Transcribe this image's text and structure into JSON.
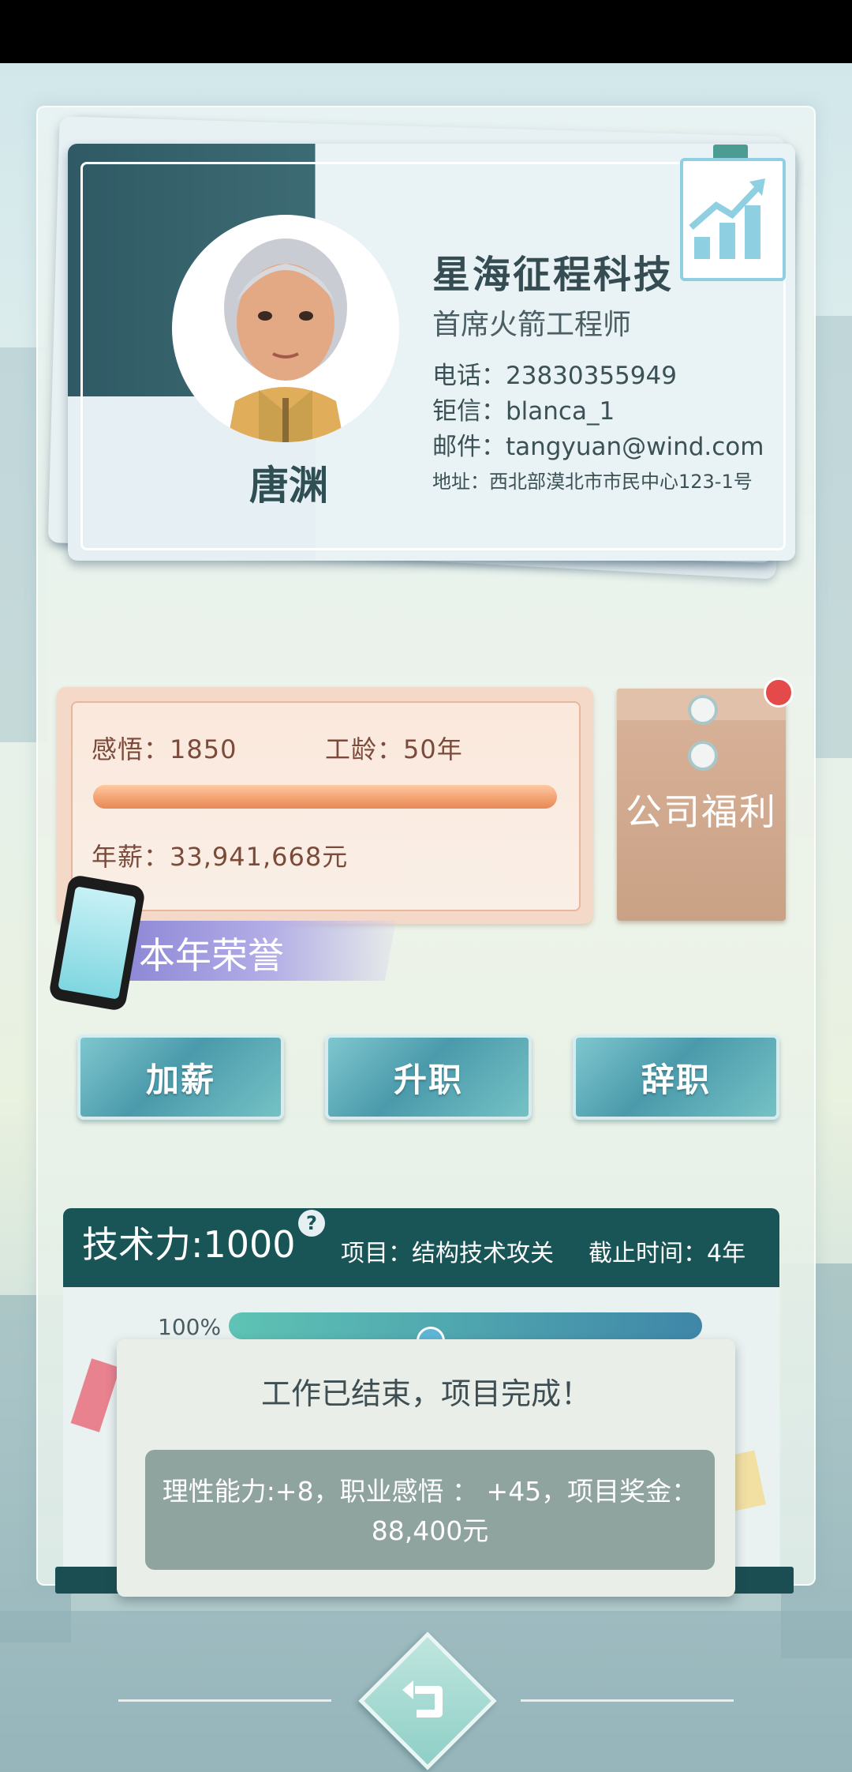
{
  "profile": {
    "name": "唐渊",
    "company": "星海征程科技",
    "job_title": "首席火箭工程师",
    "phone": "电话：23830355949",
    "chat": "钜信：blanca_1",
    "email": "邮件：tangyuan@wind.com",
    "address": "地址：西北部漠北市市民中心123-1号"
  },
  "stats": {
    "insight": "感悟：1850",
    "seniority": "工龄：50年",
    "salary": "年薪：33,941,668元",
    "progress_fraction": 1.0
  },
  "welfare": {
    "label": "公司福利",
    "has_notification": true
  },
  "honor": {
    "label": "本年荣誉"
  },
  "actions": {
    "raise": "加薪",
    "promote": "升职",
    "resign": "辞职"
  },
  "project": {
    "tech_power": "技术力:1000",
    "help": "?",
    "name": "项目：结构技术攻关",
    "deadline": "截止时间：4年",
    "percent": "100%",
    "progress_fraction": 1.0
  },
  "popup": {
    "title": "工作已结束，项目完成！",
    "rewards": "理性能力:+8，职业感悟 ： +45，项目奖金：88,400元"
  },
  "colors": {
    "header_teal": "#195457",
    "salary_bar": "#f2a06e",
    "project_bar": "#4c9fae",
    "notification": "#e54a4a"
  },
  "icons": [
    "chart-growth-icon",
    "phone-icon",
    "back-arrow-icon",
    "question-icon"
  ]
}
